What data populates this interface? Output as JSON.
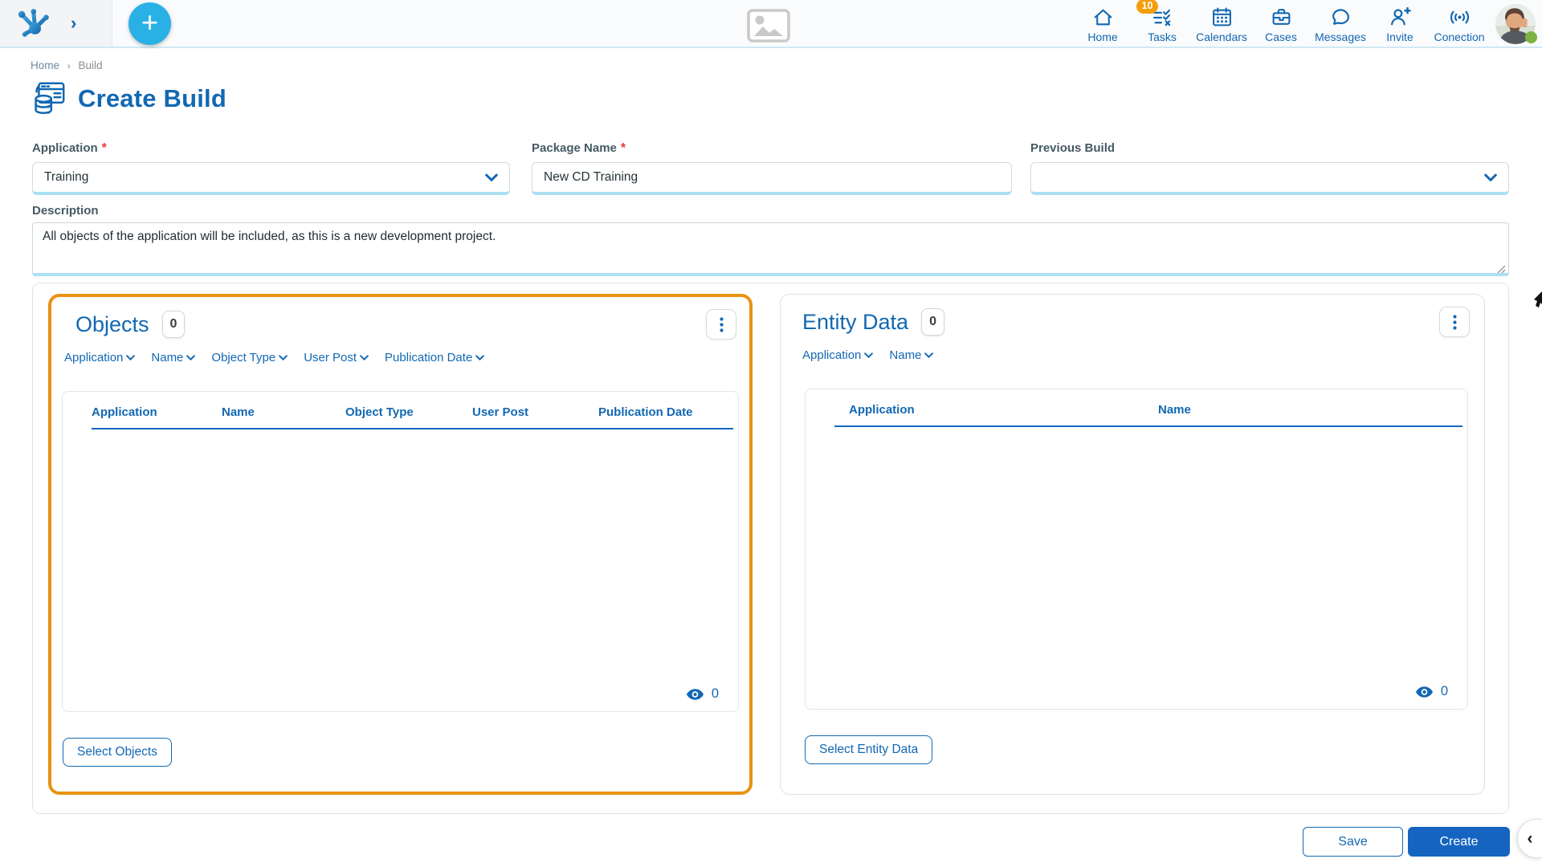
{
  "header": {
    "logo_chevron": "›",
    "plus_label": "+",
    "nav_items": [
      {
        "label": "Home",
        "icon": "home-icon"
      },
      {
        "label": "Tasks",
        "icon": "tasks-icon",
        "badge": "10"
      },
      {
        "label": "Calendars",
        "icon": "calendar-icon"
      },
      {
        "label": "Cases",
        "icon": "briefcase-icon"
      },
      {
        "label": "Messages",
        "icon": "chat-bubble-icon"
      },
      {
        "label": "Invite",
        "icon": "person-add-icon"
      },
      {
        "label": "Conection",
        "icon": "signal-icon"
      }
    ],
    "avatar_status_color": "#7CB342"
  },
  "breadcrumb": {
    "home": "Home",
    "separator": "›",
    "current": "Build"
  },
  "page": {
    "title": "Create Build",
    "title_icon": "build-package-icon"
  },
  "form": {
    "required_marker": "*",
    "application": {
      "label": "Application",
      "required": true,
      "value": "Training"
    },
    "package_name": {
      "label": "Package Name",
      "required": true,
      "value": "New CD Training"
    },
    "previous_build": {
      "label": "Previous Build",
      "required": false,
      "value": ""
    },
    "description": {
      "label": "Description",
      "value": "All objects of the application will be included, as this is a new development project."
    }
  },
  "objects_panel": {
    "title": "Objects",
    "count": "0",
    "filters": [
      "Application",
      "Name",
      "Object Type",
      "User Post",
      "Publication Date"
    ],
    "columns": [
      "Application",
      "Name",
      "Object Type",
      "User Post",
      "Publication Date"
    ],
    "rows": [],
    "visible_count": "0",
    "select_button": "Select Objects",
    "highlighted": true,
    "highlight_color": "#E8930F"
  },
  "entity_panel": {
    "title": "Entity Data",
    "count": "0",
    "filters": [
      "Application",
      "Name"
    ],
    "columns": [
      "Application",
      "Name"
    ],
    "rows": [],
    "visible_count": "0",
    "select_button": "Select Entity Data",
    "highlighted": false
  },
  "footer": {
    "save_label": "Save",
    "create_label": "Create"
  },
  "side_tab": {
    "glyph": "‹"
  },
  "colors": {
    "primary_blue": "#1268B3",
    "accent_cyan": "#29B1E6",
    "button_blue": "#1565C0",
    "table_rule_blue": "#1565C0",
    "highlight_orange": "#E8930F",
    "badge_orange": "#F59E0B",
    "status_green": "#7CB342",
    "field_underline": "#ABDFF4"
  }
}
